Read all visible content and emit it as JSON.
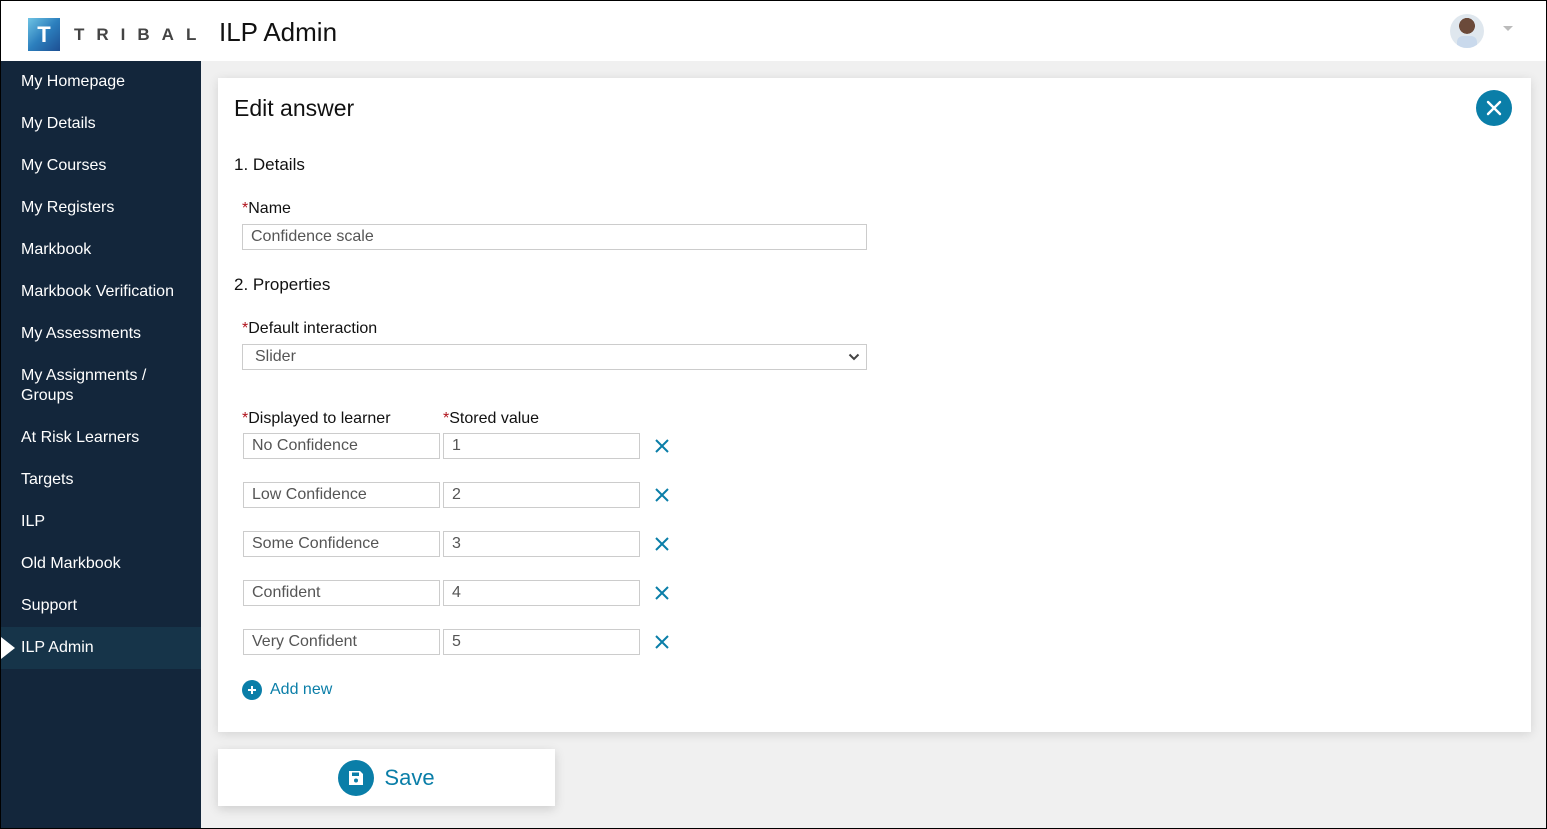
{
  "header": {
    "logo_letter": "T",
    "logo_text": "TRIBAL",
    "app_title": "ILP Admin"
  },
  "sidebar": {
    "items": [
      {
        "label": "My Homepage"
      },
      {
        "label": "My Details"
      },
      {
        "label": "My Courses"
      },
      {
        "label": "My Registers"
      },
      {
        "label": "Markbook"
      },
      {
        "label": "Markbook Verification"
      },
      {
        "label": "My Assessments"
      },
      {
        "label": "My Assignments / Groups"
      },
      {
        "label": "At Risk Learners"
      },
      {
        "label": "Targets"
      },
      {
        "label": "ILP"
      },
      {
        "label": "Old Markbook"
      },
      {
        "label": "Support"
      },
      {
        "label": "ILP Admin",
        "active": true
      }
    ]
  },
  "form": {
    "title": "Edit answer",
    "section1": "1. Details",
    "name_label": "Name",
    "name_value": "Confidence scale",
    "section2": "2. Properties",
    "interaction_label": "Default interaction",
    "interaction_value": "Slider",
    "displayed_label": "Displayed to learner",
    "stored_label": "Stored value",
    "required_mark": "*",
    "rows": [
      {
        "displayed": "No Confidence",
        "stored": "1"
      },
      {
        "displayed": "Low Confidence",
        "stored": "2"
      },
      {
        "displayed": "Some Confidence",
        "stored": "3"
      },
      {
        "displayed": "Confident",
        "stored": "4"
      },
      {
        "displayed": "Very Confident",
        "stored": "5"
      }
    ],
    "add_new_label": "Add new",
    "save_label": "Save"
  },
  "colors": {
    "accent": "#0a7ea8",
    "sidebar_bg": "#13263b",
    "sidebar_active": "#163449",
    "required": "#b0121b"
  }
}
